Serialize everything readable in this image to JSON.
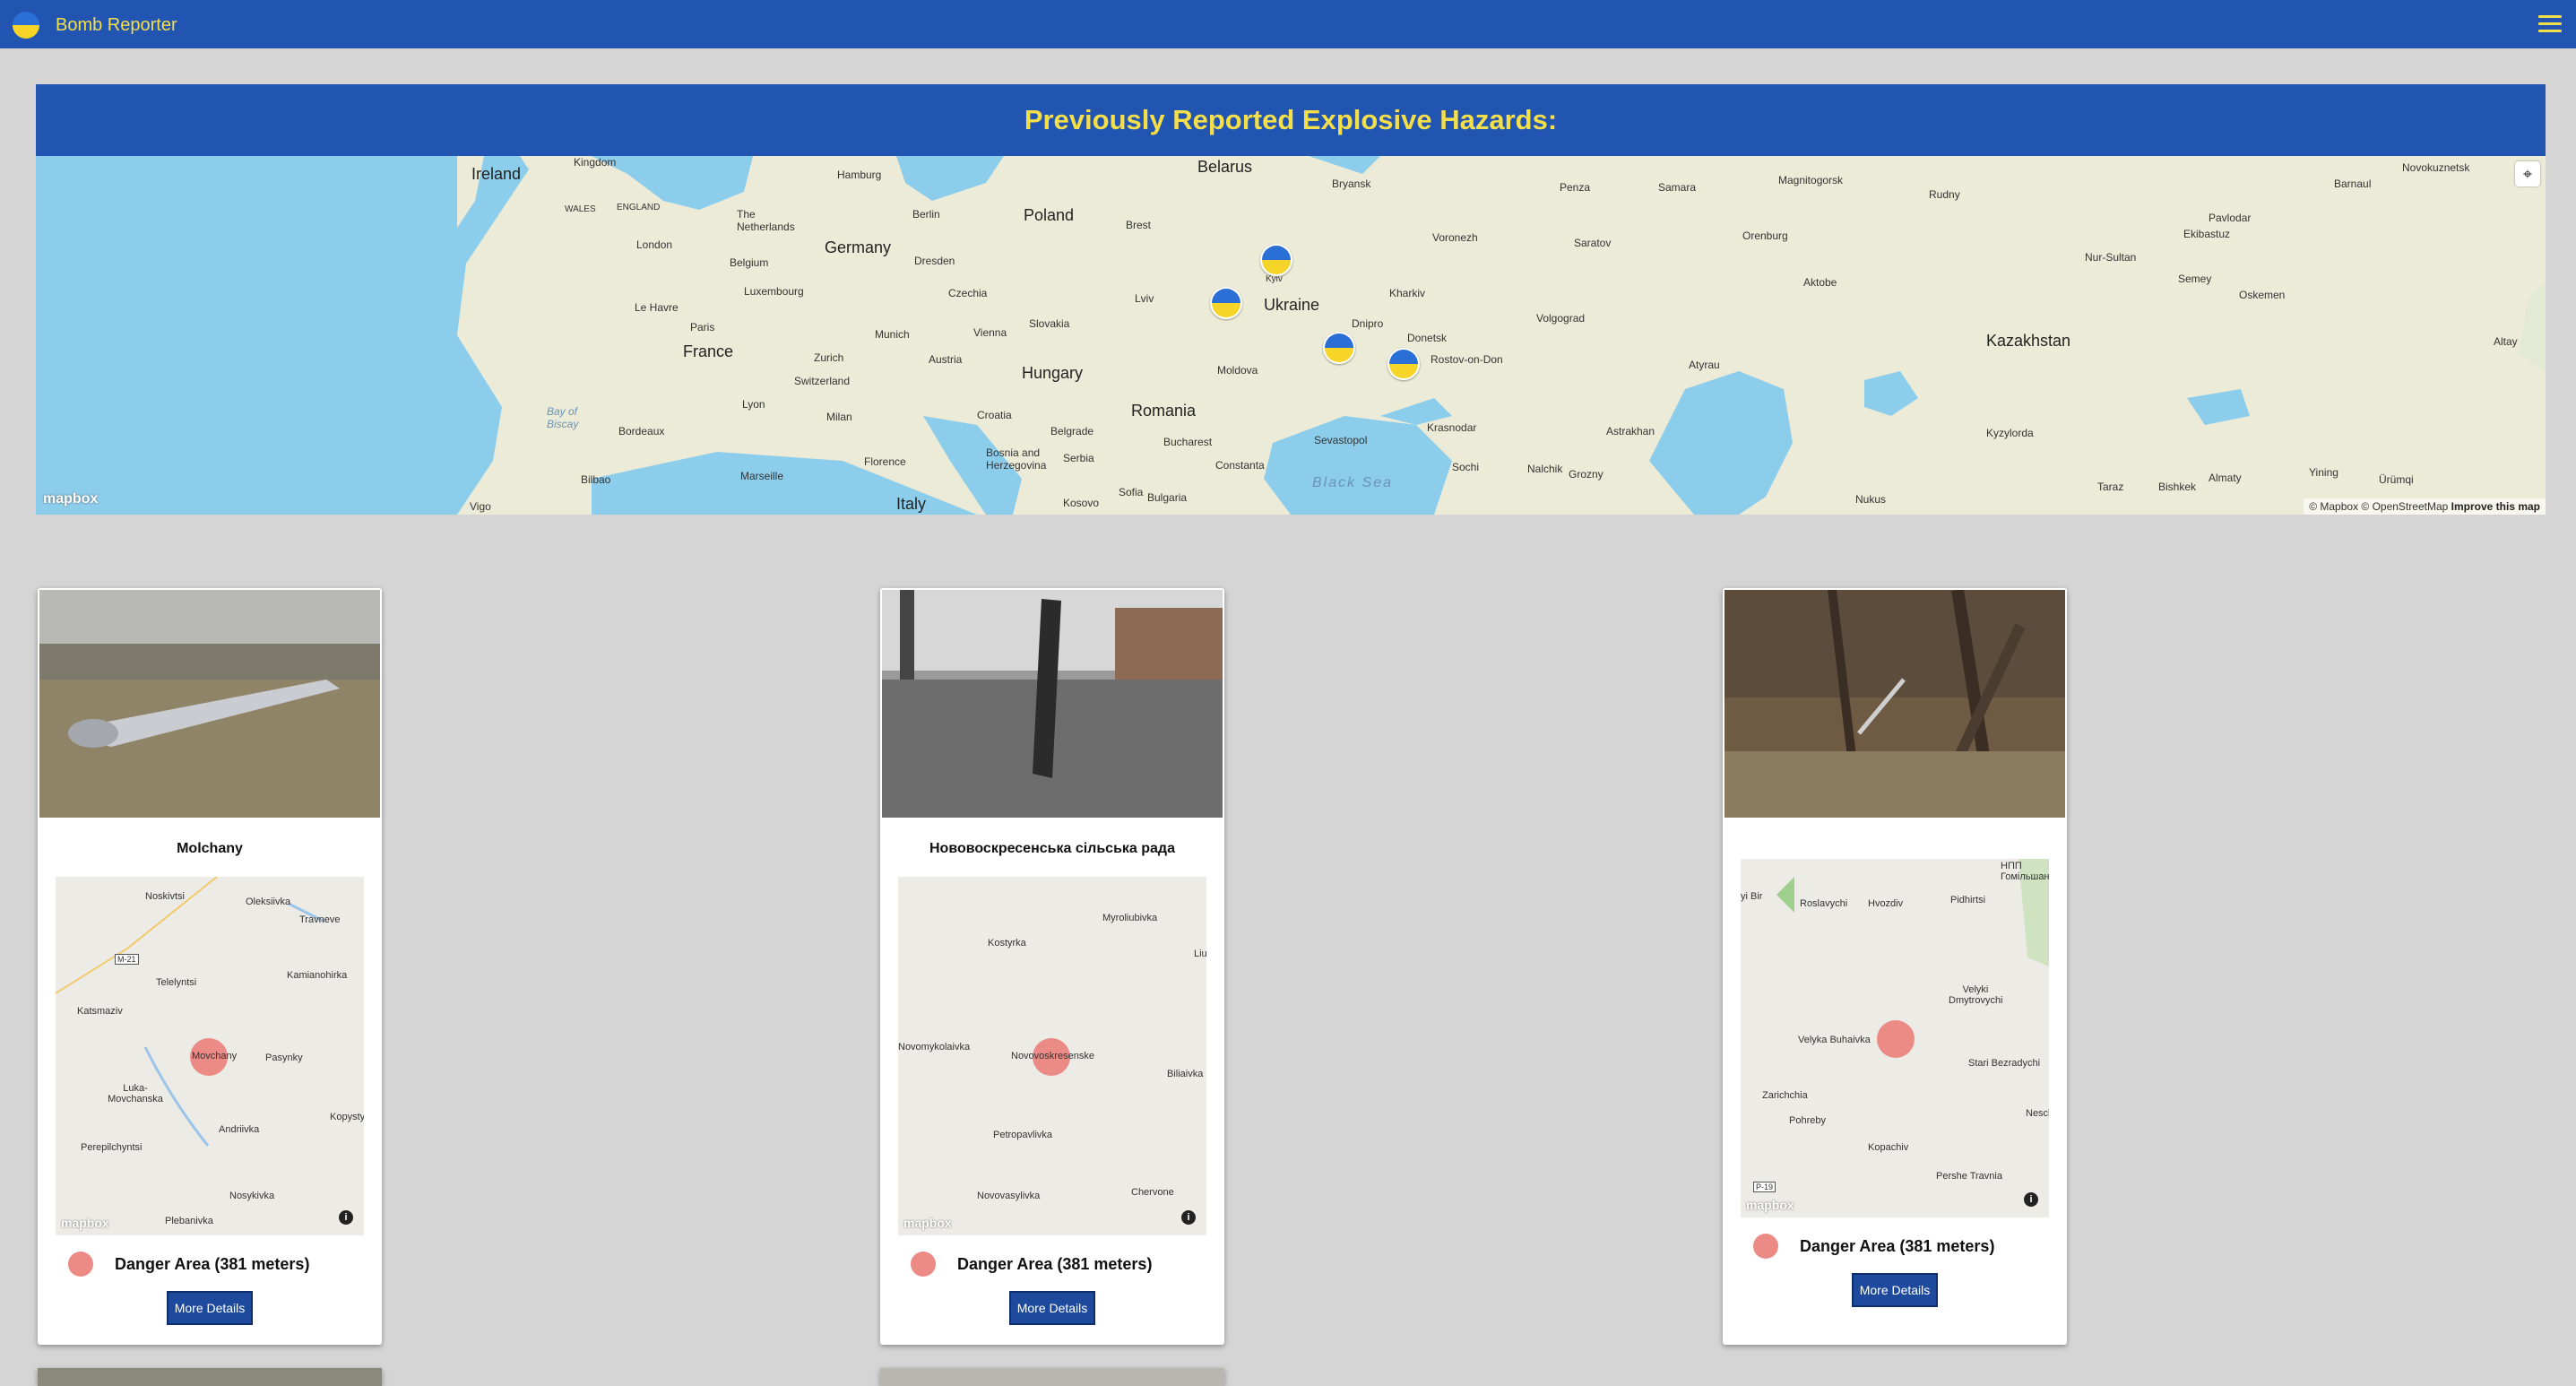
{
  "navbar": {
    "brand": "Bomb Reporter",
    "menu_icon": "hamburger-menu-icon"
  },
  "map": {
    "header": "Previously Reported Explosive Hazards:",
    "labels": {
      "countries": [
        "Ireland",
        "Belarus",
        "Poland",
        "Germany",
        "Ukraine",
        "France",
        "Hungary",
        "Romania",
        "Kazakhstan",
        "Italy"
      ],
      "cities": [
        "Kingdom",
        "Hamburg",
        "Bryansk",
        "Penza",
        "Samara",
        "Magnitogorsk",
        "Rudny",
        "Novokuznetsk",
        "Barnaul",
        "WALES",
        "ENGLAND",
        "Berlin",
        "The Netherlands",
        "London",
        "Brest",
        "Voronezh",
        "Saratov",
        "Orenburg",
        "Pavlodar",
        "Ekibastuz",
        "Nur-Sultan",
        "Belgium",
        "Luxembourg",
        "Dresden",
        "Kharkiv",
        "Aktobe",
        "Semey",
        "Oskemen",
        "Le Havre",
        "Czechia",
        "Lviv",
        "Kyiv",
        "Paris",
        "Munich",
        "Vienna",
        "Slovakia",
        "Dnipro",
        "Donetsk",
        "Volgograd",
        "Rostov-on-Don",
        "Zurich",
        "Austria",
        "Moldova",
        "Atyrau",
        "Altay",
        "Switzerland",
        "Lyon",
        "Croatia",
        "Milan",
        "Belgrade",
        "Bucharest",
        "Astrakhan",
        "Sevastopol",
        "Krasnodar",
        "Kyzylorda",
        "Bay of Biscay",
        "Bordeaux",
        "Bosnia and Herzegovina",
        "Serbia",
        "Florence",
        "Constanta",
        "Marseille",
        "Bilbao",
        "Sofia",
        "Bulgaria",
        "Sochi",
        "Nalchik",
        "Grozny",
        "Kosovo",
        "Nukus",
        "Taraz",
        "Bishkek",
        "Almaty",
        "Ürümqi",
        "Yining",
        "Vigo"
      ],
      "sea": "Black Sea"
    },
    "mapbox_logo": "mapbox",
    "attribution": "© Mapbox © OpenStreetMap",
    "improve": "Improve this map",
    "geolocate_icon": "geolocate-icon"
  },
  "cards": [
    {
      "title": "Molchany",
      "map_labels": [
        "Noskivtsi",
        "Oleksiivka",
        "Travneve",
        "M-21",
        "Telelyntsi",
        "Kamianohirka",
        "Katsmaziv",
        "Movchany",
        "Pasynky",
        "Luka-Movchanska",
        "Kopysty",
        "Andriivka",
        "Perepilchyntsi",
        "Nosykivka",
        "Plebanivka"
      ],
      "legend": "Danger Area (381 meters)",
      "button": "More Details"
    },
    {
      "title": "Нововоскресенська сільська рада",
      "map_labels": [
        "Myroliubivka",
        "Kostyrka",
        "Liu",
        "Novomykolaivka",
        "Novovoskresenske",
        "Biliaivka",
        "Petropavlivka",
        "Novovasylivka",
        "Chervone"
      ],
      "legend": "Danger Area (381 meters)",
      "button": "More Details"
    },
    {
      "title": "",
      "map_labels": [
        "НПП Гомільшан",
        "yi Bir",
        "Roslavychi",
        "Hvozdiv",
        "Pidhirtsi",
        "Velyki Dmytrovychi",
        "Velyka Buhaivka",
        "Stari Bezradychi",
        "Zarichchia",
        "Pohreby",
        "Nesch",
        "Kopachiv",
        "Pershe Travnia",
        "P-19"
      ],
      "legend": "Danger Area (381 meters)",
      "button": "More Details"
    }
  ],
  "mapbox_mini_logo": "mapbox",
  "info_icon": "i"
}
